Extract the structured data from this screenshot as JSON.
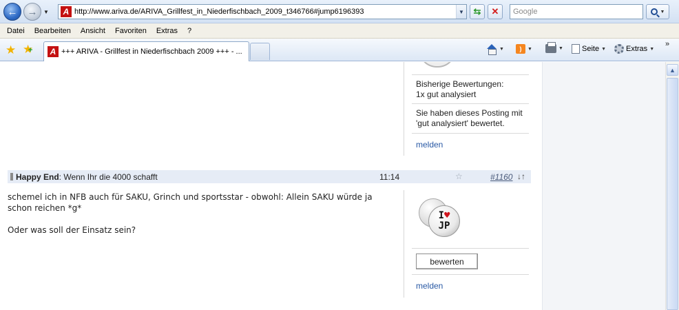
{
  "browser": {
    "url": "http://www.ariva.de/ARIVA_Grillfest_in_Niederfischbach_2009_t346766#jump6196393",
    "search_placeholder": "Google",
    "back_label": "←",
    "forward_label": "→"
  },
  "menu": [
    "Datei",
    "Bearbeiten",
    "Ansicht",
    "Favoriten",
    "Extras",
    "?"
  ],
  "tab": {
    "title": "+++ ARIVA - Grillfest in Niederfischbach 2009 +++ - ..."
  },
  "commands": {
    "page_label": "Seite",
    "tools_label": "Extras"
  },
  "side_panel_prev": {
    "ratings_heading": "Bisherige Bewertungen:",
    "ratings_value": "1x gut analysiert",
    "notice_line1": "Sie haben dieses Posting mit",
    "notice_line2": "'gut analysiert' bewertet.",
    "report_label": "melden"
  },
  "post": {
    "author": "Happy End",
    "subject": ": Wenn Ihr die 4000 schafft",
    "time": "11:14",
    "number": "#1160",
    "arrows": "↓↑",
    "body_line1": "schemel ich in NFB auch für SAKU, Grinch und sportsstar - obwohl: Allein SAKU würde ja schon reichen *g*",
    "body_line2": "Oder was soll der Einsatz sein?"
  },
  "side_panel_post": {
    "badge_top": "I",
    "badge_heart": "♥",
    "badge_bottom": "JP",
    "rate_label": "bewerten",
    "report_label": "melden"
  }
}
